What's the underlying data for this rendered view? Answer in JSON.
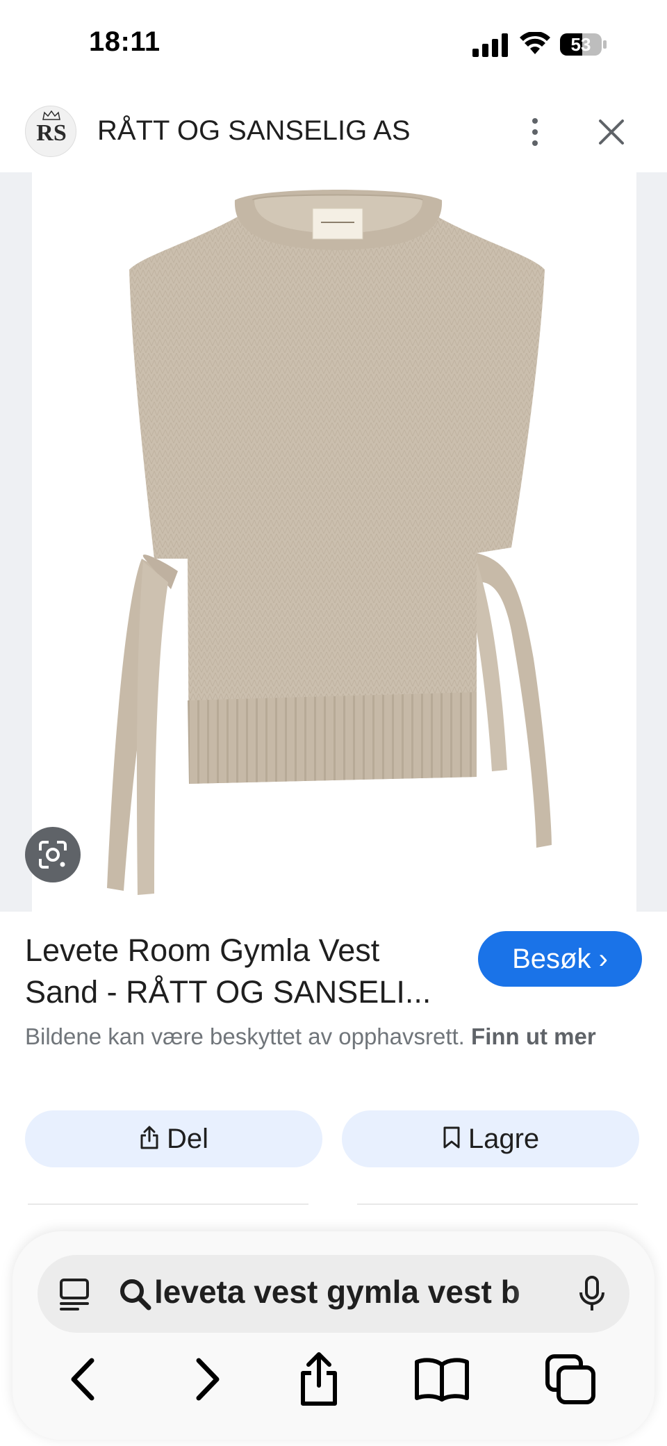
{
  "status_bar": {
    "time": "18:11",
    "battery_level": "53",
    "battery_percent": 53
  },
  "header": {
    "avatar_text": "RS",
    "site_name": "RÅTT OG SANSELIG AS",
    "icons": [
      "more-vert-icon",
      "close-icon"
    ]
  },
  "product": {
    "image_alt": "Levete Room Gymla Vest Sand",
    "title": "Levete Room Gymla Vest Sand - RÅTT OG SANSELI...",
    "visit_label": "Besøk ›",
    "copyright_text": "Bildene kan være beskyttet av opphavsrett.",
    "learn_more": "Finn ut mer"
  },
  "actions": {
    "share_label": "Del",
    "save_label": "Lagre"
  },
  "browser": {
    "url_text": "leveta vest gymla vest b",
    "nav_icons": [
      "back-icon",
      "forward-icon",
      "share-icon",
      "bookmarks-icon",
      "tabs-icon"
    ]
  },
  "colors": {
    "accent": "#1a73e8",
    "action_bg": "#e8f0fe",
    "knit": "#cbbfae"
  }
}
